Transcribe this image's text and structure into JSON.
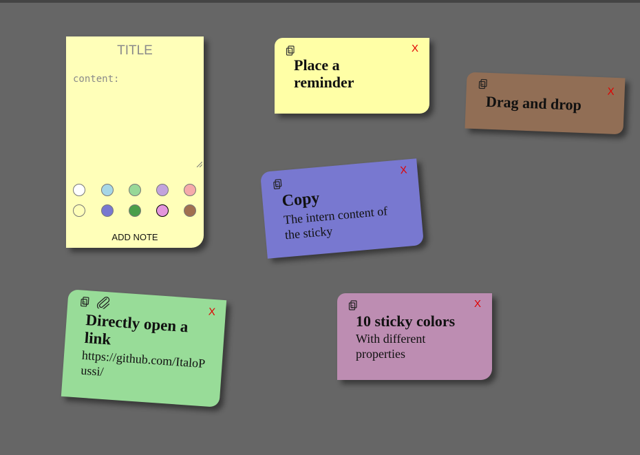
{
  "editor": {
    "title": "TITLE",
    "content_placeholder": "content:",
    "add_button_label": "ADD NOTE",
    "swatches": [
      {
        "name": "white",
        "color": "#ffffff"
      },
      {
        "name": "light-blue",
        "color": "#a6d6e6"
      },
      {
        "name": "light-green",
        "color": "#98d898"
      },
      {
        "name": "lavender",
        "color": "#c2a3dc"
      },
      {
        "name": "pink",
        "color": "#f5aaaa"
      },
      {
        "name": "light-yellow",
        "color": "#ffffb9"
      },
      {
        "name": "periwinkle",
        "color": "#7878d0"
      },
      {
        "name": "green",
        "color": "#4a9e4a"
      },
      {
        "name": "orchid",
        "color": "#e496dc",
        "selected": true
      },
      {
        "name": "brown",
        "color": "#a07050"
      }
    ]
  },
  "notes": {
    "reminder": {
      "title": "Place a reminder",
      "close": "X",
      "color": "#ffffa6"
    },
    "drag": {
      "title": "Drag and drop",
      "close": "X",
      "color": "#916e55"
    },
    "copy": {
      "title": "Copy",
      "body": "The intern content of the sticky",
      "close": "X",
      "color": "#7878d0"
    },
    "link": {
      "title": "Directly open a link",
      "body": "https://github.com/ItaloPussi/",
      "close": "X",
      "color": "#98dc98"
    },
    "colors": {
      "title": "10 sticky colors",
      "body": "With different properties",
      "close": "X",
      "color": "#bd8db2"
    }
  },
  "colors": {
    "background": "#666666",
    "close": "#e00000"
  }
}
